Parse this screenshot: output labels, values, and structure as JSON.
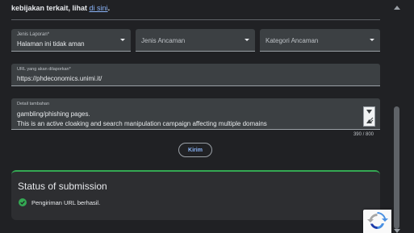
{
  "intro": {
    "text": "kebijakan terkait, lihat ",
    "link": "di sini",
    "suffix": "."
  },
  "form": {
    "report_type": {
      "label": "Jenis Laporan*",
      "value": "Halaman ini tidak aman"
    },
    "threat_type": {
      "placeholder": "Jenis Ancaman"
    },
    "threat_category": {
      "placeholder": "Kategori Ancaman"
    },
    "url_field": {
      "label": "URL yang akan dilaporkan*",
      "value": "https://phdeconomics.unimi.it/"
    },
    "details_field": {
      "label": "Detail tambahan",
      "line1": "gambling/phishing pages.",
      "line2": "This is an active cloaking and search manipulation campaign affecting multiple domains"
    },
    "counter": "390 / 800",
    "submit_label": "Kirim"
  },
  "status": {
    "title": "Status of submission",
    "message": "Pengiriman URL berhasil.",
    "accent_color": "#34a853"
  },
  "icons": {
    "check": "check-circle-icon",
    "dropdown": "chevron-down-icon",
    "recaptcha": "recaptcha-icon"
  }
}
